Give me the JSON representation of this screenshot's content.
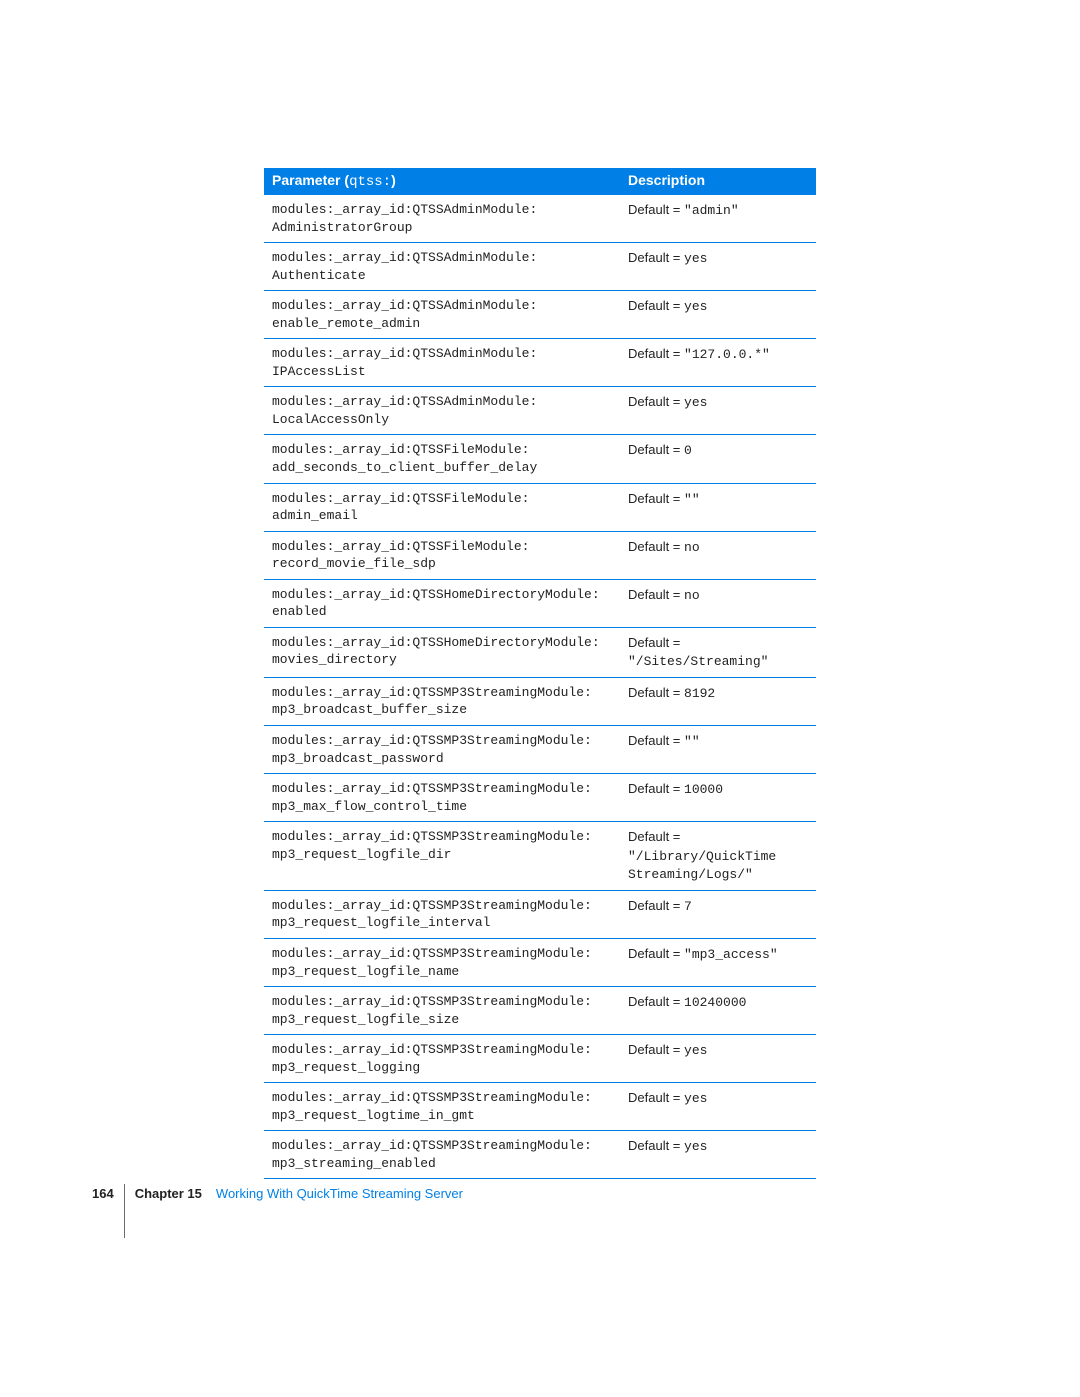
{
  "table": {
    "header_param_label": "Parameter",
    "header_param_prefix": "(",
    "header_param_mono": "qtss:",
    "header_param_suffix": ")",
    "header_desc": "Description",
    "default_label": "Default = ",
    "rows": [
      {
        "param": "modules:_array_id:QTSSAdminModule:\nAdministratorGroup",
        "default_value": "\"admin\""
      },
      {
        "param": "modules:_array_id:QTSSAdminModule:\nAuthenticate",
        "default_value": "yes"
      },
      {
        "param": "modules:_array_id:QTSSAdminModule:\nenable_remote_admin",
        "default_value": "yes"
      },
      {
        "param": "modules:_array_id:QTSSAdminModule:\nIPAccessList",
        "default_value": "\"127.0.0.*\""
      },
      {
        "param": "modules:_array_id:QTSSAdminModule:\nLocalAccessOnly",
        "default_value": "yes"
      },
      {
        "param": "modules:_array_id:QTSSFileModule:\nadd_seconds_to_client_buffer_delay",
        "default_value": "0"
      },
      {
        "param": "modules:_array_id:QTSSFileModule:\nadmin_email",
        "default_value": "\"\""
      },
      {
        "param": "modules:_array_id:QTSSFileModule:\nrecord_movie_file_sdp",
        "default_value": "no"
      },
      {
        "param": "modules:_array_id:QTSSHomeDirectoryModule:\nenabled",
        "default_value": "no"
      },
      {
        "param": "modules:_array_id:QTSSHomeDirectoryModule:\nmovies_directory",
        "default_value": "\n\"/Sites/Streaming\""
      },
      {
        "param": "modules:_array_id:QTSSMP3StreamingModule:\nmp3_broadcast_buffer_size",
        "default_value": "8192"
      },
      {
        "param": "modules:_array_id:QTSSMP3StreamingModule:\nmp3_broadcast_password",
        "default_value": "\"\""
      },
      {
        "param": "modules:_array_id:QTSSMP3StreamingModule:\nmp3_max_flow_control_time",
        "default_value": "10000"
      },
      {
        "param": "modules:_array_id:QTSSMP3StreamingModule:\nmp3_request_logfile_dir",
        "default_value": "\n\"/Library/QuickTime\nStreaming/Logs/\""
      },
      {
        "param": "modules:_array_id:QTSSMP3StreamingModule:\nmp3_request_logfile_interval",
        "default_value": "7"
      },
      {
        "param": "modules:_array_id:QTSSMP3StreamingModule:\nmp3_request_logfile_name",
        "default_value": "\"mp3_access\""
      },
      {
        "param": "modules:_array_id:QTSSMP3StreamingModule:\nmp3_request_logfile_size",
        "default_value": "10240000"
      },
      {
        "param": "modules:_array_id:QTSSMP3StreamingModule:\nmp3_request_logging",
        "default_value": "yes"
      },
      {
        "param": "modules:_array_id:QTSSMP3StreamingModule:\nmp3_request_logtime_in_gmt",
        "default_value": "yes"
      },
      {
        "param": "modules:_array_id:QTSSMP3StreamingModule:\nmp3_streaming_enabled",
        "default_value": "yes"
      }
    ]
  },
  "footer": {
    "page_number": "164",
    "chapter_label": "Chapter 15",
    "chapter_title": "Working With QuickTime Streaming Server"
  }
}
